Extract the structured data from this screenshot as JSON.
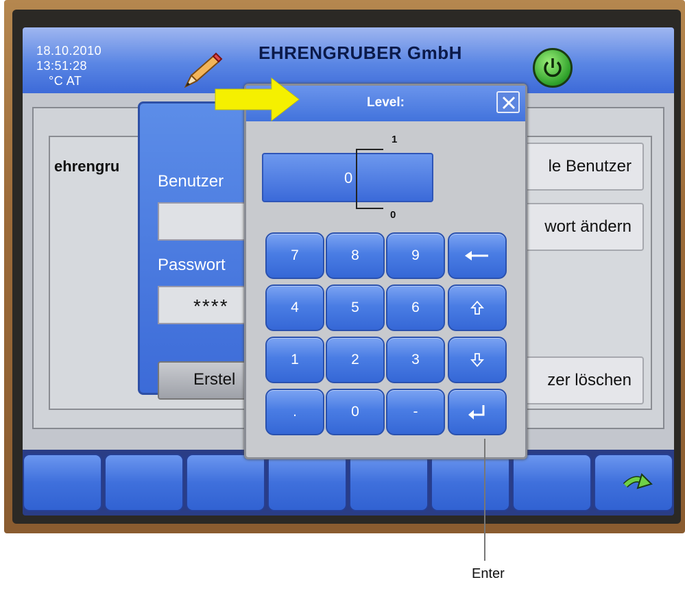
{
  "header": {
    "date": "18.10.2010",
    "time": "13:51:28",
    "unit": "°C AT",
    "company": "EHRENGRUBER GmbH",
    "icons": [
      "pencil-icon",
      "power-icon"
    ]
  },
  "main": {
    "user_list": [
      "ehrengru"
    ],
    "right_buttons": {
      "all_users": "le Benutzer",
      "change_password": "wort ändern",
      "delete_user": "zer löschen"
    }
  },
  "login_dialog": {
    "user_label": "Benutzer",
    "user_value": "",
    "password_label": "Passwort",
    "password_value": "****",
    "create_button": "Erstel"
  },
  "keypad_dialog": {
    "title": "Level:",
    "value": "0",
    "max": "1",
    "min": "0",
    "keys": [
      "7",
      "8",
      "9",
      "←",
      "4",
      "5",
      "6",
      "⇧",
      "1",
      "2",
      "3",
      "⇩",
      ".",
      "0",
      "-",
      "↵"
    ]
  },
  "colors": {
    "accent_blue": "#4a7de4",
    "arrow_yellow": "#f5f000",
    "power_green": "#2ea02a"
  },
  "callout": {
    "label": "Enter"
  }
}
